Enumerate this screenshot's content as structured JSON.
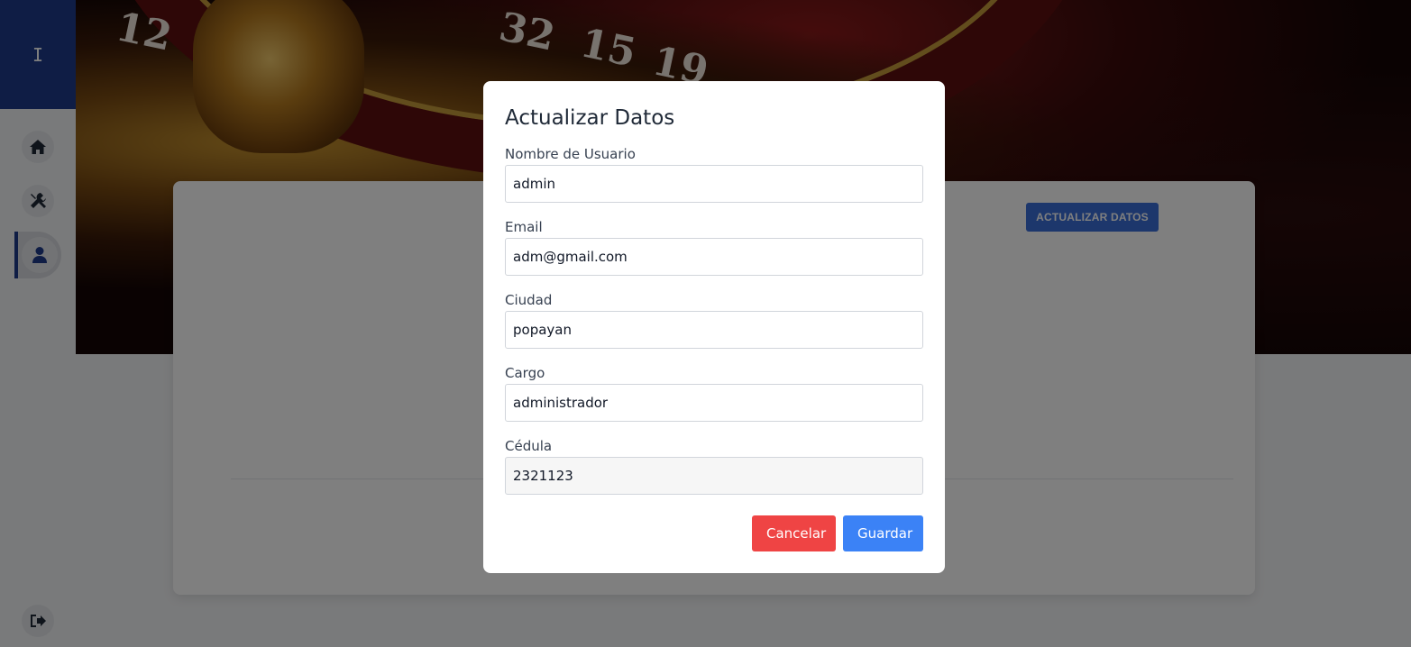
{
  "sidebar": {
    "logo_text": "I",
    "items": [
      {
        "icon": "home-icon"
      },
      {
        "icon": "tools-icon"
      },
      {
        "icon": "user-icon"
      }
    ],
    "logout_icon": "logout-icon",
    "accent_color": "#1e3a8a"
  },
  "hero": {
    "numbers": [
      "12",
      "32",
      "15",
      "19"
    ]
  },
  "card": {
    "update_button_label": "ACTUALIZAR DATOS"
  },
  "modal": {
    "title": "Actualizar Datos",
    "fields": [
      {
        "label": "Nombre de Usuario",
        "value": "admin"
      },
      {
        "label": "Email",
        "value": "adm@gmail.com"
      },
      {
        "label": "Ciudad",
        "value": "popayan"
      },
      {
        "label": "Cargo",
        "value": "administrador"
      },
      {
        "label": "Cédula",
        "value": "2321123"
      }
    ],
    "cancel_label": "Cancelar",
    "save_label": "Guardar",
    "cancel_color": "#ef4444",
    "save_color": "#3b82f6"
  }
}
